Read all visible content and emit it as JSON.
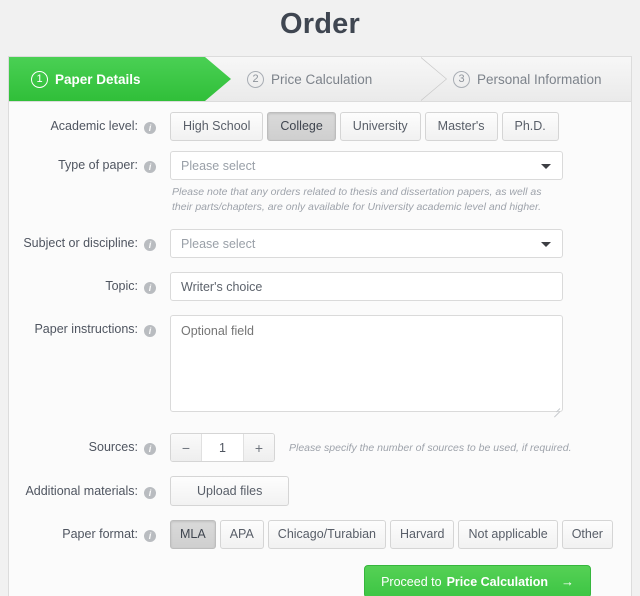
{
  "page": {
    "title": "Order"
  },
  "steps": [
    {
      "num": "1",
      "label": "Paper Details",
      "state": "active"
    },
    {
      "num": "2",
      "label": "Price Calculation",
      "state": "inactive"
    },
    {
      "num": "3",
      "label": "Personal Information",
      "state": "inactive"
    }
  ],
  "form": {
    "academic_level": {
      "label": "Academic level:",
      "options": [
        "High School",
        "College",
        "University",
        "Master's",
        "Ph.D."
      ],
      "selected": "College"
    },
    "type_of_paper": {
      "label": "Type of paper:",
      "placeholder": "Please select",
      "value": "Please select",
      "note": "Please note that any orders related to thesis and dissertation papers, as well as their parts/chapters, are only available for University academic level and higher."
    },
    "subject": {
      "label": "Subject or discipline:",
      "placeholder": "Please select",
      "value": "Please select"
    },
    "topic": {
      "label": "Topic:",
      "value": "Writer's choice",
      "placeholder": "Writer's choice"
    },
    "paper_instructions": {
      "label": "Paper instructions:",
      "placeholder": "Optional field",
      "value": ""
    },
    "sources": {
      "label": "Sources:",
      "decrement": "−",
      "increment": "+",
      "value": "1",
      "hint": "Please specify the number of sources to be used, if required."
    },
    "additional_materials": {
      "label": "Additional materials:",
      "button": "Upload files"
    },
    "paper_format": {
      "label": "Paper format:",
      "options": [
        "MLA",
        "APA",
        "Chicago/Turabian",
        "Harvard",
        "Not applicable",
        "Other"
      ],
      "selected": "MLA"
    }
  },
  "footer": {
    "proceed_prefix": "Proceed to ",
    "proceed_strong": "Price Calculation",
    "proceed_arrow": "→"
  },
  "icons": {
    "info": "i"
  },
  "colors": {
    "accent_green": "#3dc544",
    "title_text": "#3f4651",
    "page_bg": "#f1f1f1",
    "card_bg": "#fbfbfb"
  }
}
